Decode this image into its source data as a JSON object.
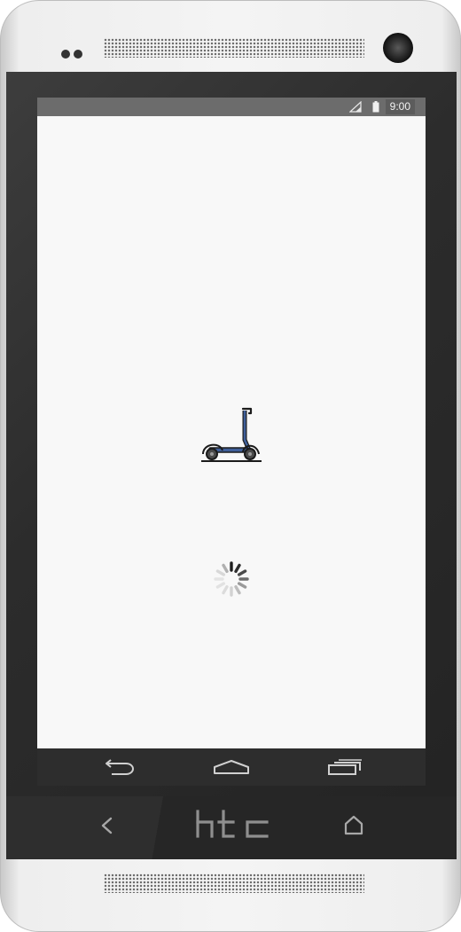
{
  "device": {
    "brand_logo": "htc"
  },
  "status_bar": {
    "time": "9:00",
    "icons": [
      "signal-icon",
      "battery-icon"
    ]
  },
  "app": {
    "logo_icon": "kick-scooter-icon",
    "loading_indicator": "spinner-icon"
  },
  "navigation_bar": {
    "buttons": [
      "back-icon",
      "home-icon",
      "recent-apps-icon"
    ]
  },
  "colors": {
    "screen_background": "#f8f8f8",
    "status_bar": "#6c6c6c",
    "navigation_bar": "#2d2d2d",
    "scooter_accent": "#3f5f9a"
  }
}
